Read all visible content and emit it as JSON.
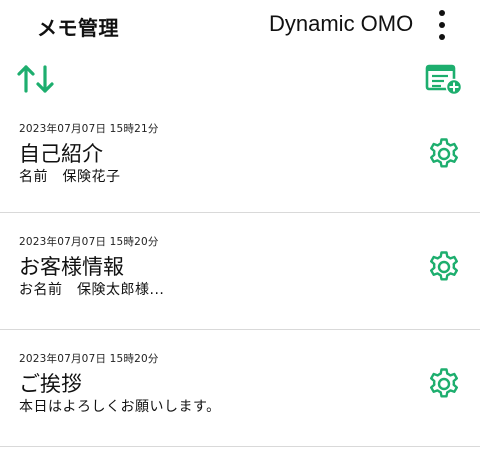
{
  "header": {
    "title": "メモ管理",
    "account": "Dynamic OMO"
  },
  "icons": {
    "menu": "more-vertical-icon",
    "sort": "sort-arrows-icon",
    "new_memo": "new-memo-icon",
    "settings": "gear-icon"
  },
  "colors": {
    "accent": "#1dae6e"
  },
  "memos": [
    {
      "date": "2023年07月07日 15時21分",
      "title": "自己紹介",
      "body": "名前　保険花子"
    },
    {
      "date": "2023年07月07日 15時20分",
      "title": "お客様情報",
      "body": "お名前　保険太郎様..."
    },
    {
      "date": "2023年07月07日 15時20分",
      "title": "ご挨拶",
      "body": "本日はよろしくお願いします。"
    }
  ]
}
